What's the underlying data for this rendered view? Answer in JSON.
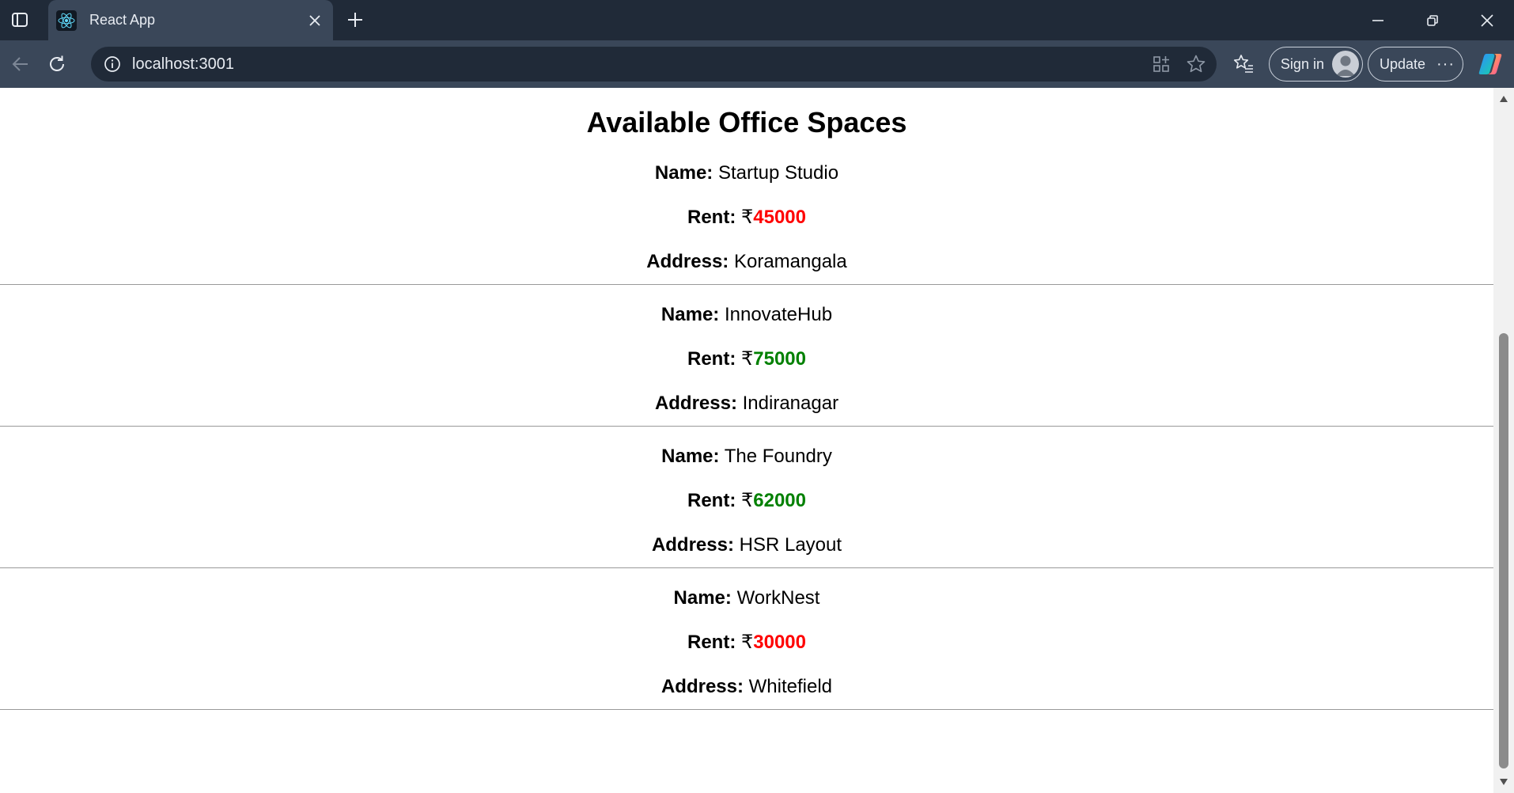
{
  "browser": {
    "tab_title": "React App",
    "url": "localhost:3001",
    "sign_in_label": "Sign in",
    "update_label": "Update",
    "icons": {
      "tab_actions": "tab-actions-icon",
      "favicon": "react-logo-icon",
      "close": "close-icon",
      "new_tab": "plus-icon",
      "minimize": "minimize-icon",
      "restore": "restore-icon",
      "window_close": "close-icon",
      "back": "back-arrow-icon",
      "refresh": "refresh-icon",
      "info": "info-icon",
      "app_available": "apps-icon",
      "favorite": "star-icon",
      "favorites": "favorites-icon",
      "more": "more-icon",
      "copilot": "copilot-icon"
    }
  },
  "page": {
    "title": "Available Office Spaces",
    "labels": {
      "name": "Name:",
      "rent": "Rent:",
      "address": "Address:",
      "currency": "₹"
    },
    "spaces": [
      {
        "name": "Startup Studio",
        "rent": "45000",
        "address": "Koramangala",
        "rent_color": "#ff0000"
      },
      {
        "name": "InnovateHub",
        "rent": "75000",
        "address": "Indiranagar",
        "rent_color": "#008000"
      },
      {
        "name": "The Foundry",
        "rent": "62000",
        "address": "HSR Layout",
        "rent_color": "#008000"
      },
      {
        "name": "WorkNest",
        "rent": "30000",
        "address": "Whitefield",
        "rent_color": "#ff0000"
      }
    ]
  }
}
